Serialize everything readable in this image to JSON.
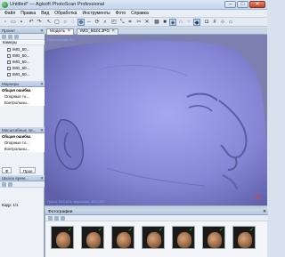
{
  "window": {
    "title": "Untitled* — Agisoft PhotoScan Professional",
    "min": "–",
    "max": "□",
    "close": "✕"
  },
  "menu": [
    "Файл",
    "Правка",
    "Вид",
    "Обработка",
    "Инструменты",
    "Фото",
    "Справка"
  ],
  "toolbar_icons": [
    "new-icon",
    "open-icon",
    "save-icon",
    "undo-icon",
    "redo-icon",
    "select-icon",
    "rect-select-icon",
    "circle-select-icon",
    "free-select-icon",
    "navigate-icon",
    "move-icon",
    "rotate-icon",
    "zoom-icon",
    "region-icon",
    "resize-icon",
    "crop-icon",
    "cut-icon",
    "delete-icon",
    "texture-icon",
    "solid-icon",
    "wireframe-icon",
    "points-icon",
    "dense-icon",
    "model-icon",
    "camera-icon",
    "grid-icon",
    "axis-icon",
    "reset-icon"
  ],
  "workspace": {
    "title": "Проект",
    "column": "Камеры",
    "items": [
      "IMG_50...",
      "IMG_50...",
      "IMG_50...",
      "IMG_50...",
      "IMG_50..."
    ]
  },
  "markers": {
    "title": "Маркеры",
    "rows": [
      {
        "label": "Общая ошибка",
        "bold": true
      },
      {
        "label": "Опорные то...",
        "bold": false
      },
      {
        "label": "Контрольны...",
        "bold": false
      }
    ]
  },
  "scalebars": {
    "title": "Масштабные ли...",
    "rows": [
      {
        "label": "Общая ошибка",
        "bold": true
      },
      {
        "label": "Опорные то...",
        "bold": false
      },
      {
        "label": "Контрольны...",
        "bold": false
      }
    ]
  },
  "left_tabs": [
    "Ф",
    "Прое"
  ],
  "console": {
    "title": "Шкала врем...",
    "frame": "Кадр: 1/1"
  },
  "doc_tabs": [
    {
      "label": "Модель",
      "active": true
    },
    {
      "label": "IMG_5024.JPG",
      "active": false
    }
  ],
  "viewport": {
    "perspective": "Перспектива 30°",
    "stats": "Грани: 913,624, вершины: 459,193"
  },
  "photos": {
    "title": "Фотографии",
    "thumb_count": 7
  },
  "colors": {
    "mesh": "#8c8ee0",
    "background": "#7d7fae",
    "accent": "#6b8fbd"
  }
}
